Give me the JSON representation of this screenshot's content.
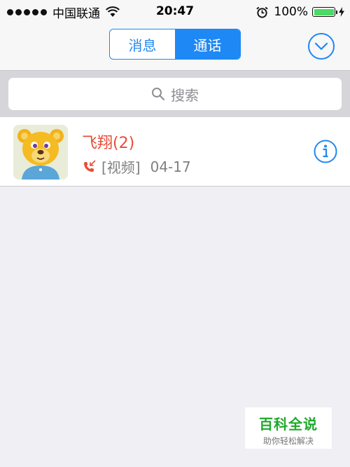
{
  "status_bar": {
    "carrier": "中国联通",
    "time": "20:47",
    "battery_percent": "100%",
    "battery_level": 1.0,
    "icons": [
      "signal-dots-icon",
      "wifi-icon",
      "alarm-icon",
      "battery-icon",
      "charging-bolt-icon"
    ]
  },
  "header": {
    "tabs": [
      {
        "label": "消息",
        "active": false
      },
      {
        "label": "通话",
        "active": true
      }
    ],
    "dropdown_icon": "chevron-down-circle-icon"
  },
  "search": {
    "placeholder": "搜索",
    "icon": "search-icon"
  },
  "calls": [
    {
      "name": "飞翔(2)",
      "type": "[视频]",
      "date": "04-17",
      "status_icon": "missed-call-icon",
      "info_icon": "info-icon",
      "avatar": "bear-avatar"
    }
  ],
  "watermark": {
    "title": "百科全说",
    "subtitle": "助你轻松解决"
  },
  "colors": {
    "accent": "#1e88f5",
    "missed": "#e84c36",
    "battery": "#4cd964",
    "watermark": "#1fa92b"
  }
}
